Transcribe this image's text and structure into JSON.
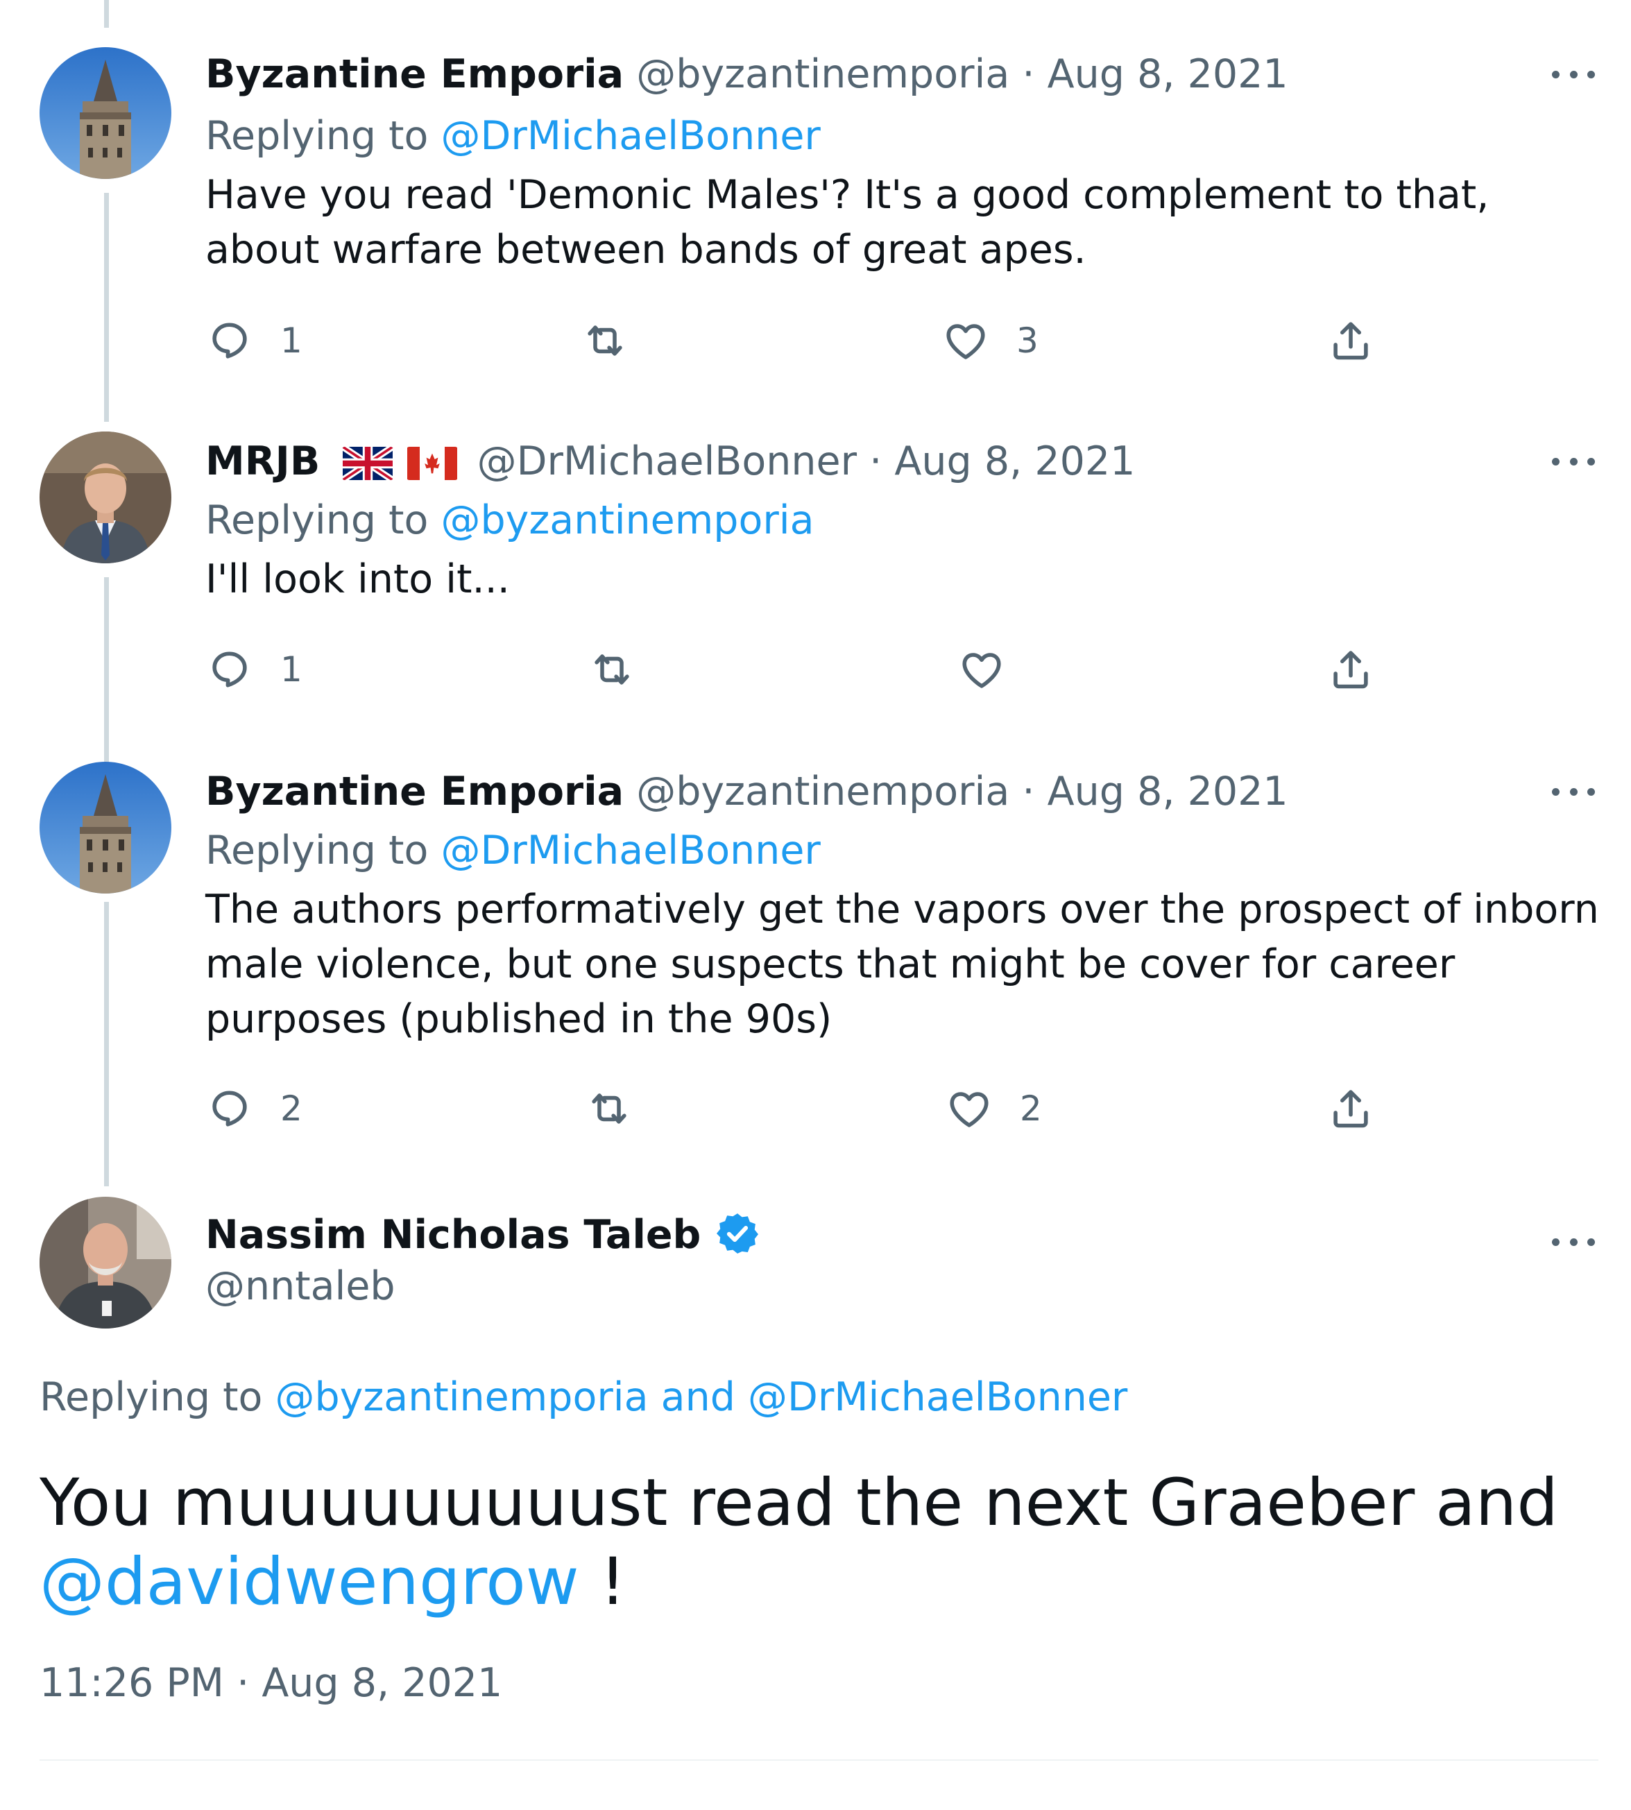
{
  "thread": [
    {
      "name": "Byzantine Emporia",
      "handle": "@byzantinemporia",
      "separator": "·",
      "date": "Aug 8, 2021",
      "replying_prefix": "Replying to ",
      "replying_to": "@DrMichaelBonner",
      "text": "Have you read 'Demonic Males'? It's a good complement to that, about warfare between bands of great apes.",
      "replies": "1",
      "retweets": "",
      "likes": "3",
      "avatar_icon": "galata-tower-avatar"
    },
    {
      "name": "MRJB",
      "flags": [
        "uk-flag",
        "canada-flag"
      ],
      "handle": "@DrMichaelBonner",
      "separator": "·",
      "date": "Aug 8, 2021",
      "replying_prefix": "Replying to ",
      "replying_to": "@byzantinemporia",
      "text": "I'll look into it...",
      "replies": "1",
      "retweets": "",
      "likes": "",
      "avatar_icon": "man-in-suit-avatar"
    },
    {
      "name": "Byzantine Emporia",
      "handle": "@byzantinemporia",
      "separator": "·",
      "date": "Aug 8, 2021",
      "replying_prefix": "Replying to ",
      "replying_to": "@DrMichaelBonner",
      "text": "The authors performatively get the vapors over the prospect of inborn male violence, but one suspects that might be cover for career purposes (published in the 90s)",
      "replies": "2",
      "retweets": "",
      "likes": "2",
      "avatar_icon": "galata-tower-avatar"
    }
  ],
  "main_tweet": {
    "name": "Nassim Nicholas Taleb",
    "verified_icon": "verified-badge-icon",
    "handle": "@nntaleb",
    "replying_prefix": "Replying to ",
    "replying_to": "@byzantinemporia and @DrMichaelBonner",
    "text_part1": "You muuuuuuuuust read the next Graeber and ",
    "text_mention": "@davidwengrow",
    "text_part2": " !",
    "time": "11:26 PM",
    "separator": "·",
    "date": "Aug 8, 2021"
  },
  "colors": {
    "text": "#0f1419",
    "secondary": "#536471",
    "accent": "#1d9bf0",
    "thread_line": "#cfd9de",
    "divider": "#eff3f4"
  },
  "icons": [
    "reply-icon",
    "retweet-icon",
    "like-icon",
    "share-icon",
    "more-icon"
  ]
}
